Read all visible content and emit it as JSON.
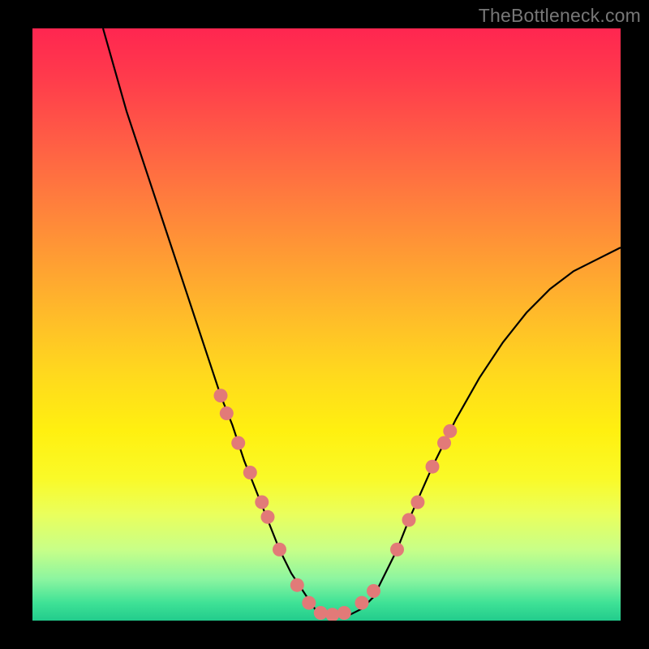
{
  "watermark": "TheBottleneck.com",
  "chart_data": {
    "type": "line",
    "title": "",
    "xlabel": "",
    "ylabel": "",
    "xlim": [
      0,
      100
    ],
    "ylim": [
      0,
      100
    ],
    "grid": false,
    "series": [
      {
        "name": "bottleneck-curve",
        "x": [
          12,
          14,
          16,
          18,
          20,
          22,
          24,
          26,
          28,
          30,
          32,
          34,
          36,
          38,
          40,
          42,
          44,
          46,
          48,
          50,
          52,
          54,
          56,
          58,
          60,
          62,
          64,
          68,
          72,
          76,
          80,
          84,
          88,
          92,
          96,
          100
        ],
        "y": [
          100,
          93,
          86,
          80,
          74,
          68,
          62,
          56,
          50,
          44,
          38,
          33,
          27,
          22,
          17,
          12,
          8,
          5,
          2,
          1,
          1,
          1,
          2,
          4,
          8,
          12,
          17,
          26,
          34,
          41,
          47,
          52,
          56,
          59,
          61,
          63
        ]
      }
    ],
    "markers": [
      {
        "x": 32,
        "y": 38
      },
      {
        "x": 33,
        "y": 35
      },
      {
        "x": 35,
        "y": 30
      },
      {
        "x": 37,
        "y": 25
      },
      {
        "x": 39,
        "y": 20
      },
      {
        "x": 40,
        "y": 17.5
      },
      {
        "x": 42,
        "y": 12
      },
      {
        "x": 45,
        "y": 6
      },
      {
        "x": 47,
        "y": 3
      },
      {
        "x": 49,
        "y": 1.3
      },
      {
        "x": 51,
        "y": 1
      },
      {
        "x": 53,
        "y": 1.3
      },
      {
        "x": 56,
        "y": 3
      },
      {
        "x": 58,
        "y": 5
      },
      {
        "x": 62,
        "y": 12
      },
      {
        "x": 64,
        "y": 17
      },
      {
        "x": 65.5,
        "y": 20
      },
      {
        "x": 68,
        "y": 26
      },
      {
        "x": 70,
        "y": 30
      },
      {
        "x": 71,
        "y": 32
      }
    ],
    "marker_color": "#e27a78",
    "curve_color": "#000000"
  }
}
